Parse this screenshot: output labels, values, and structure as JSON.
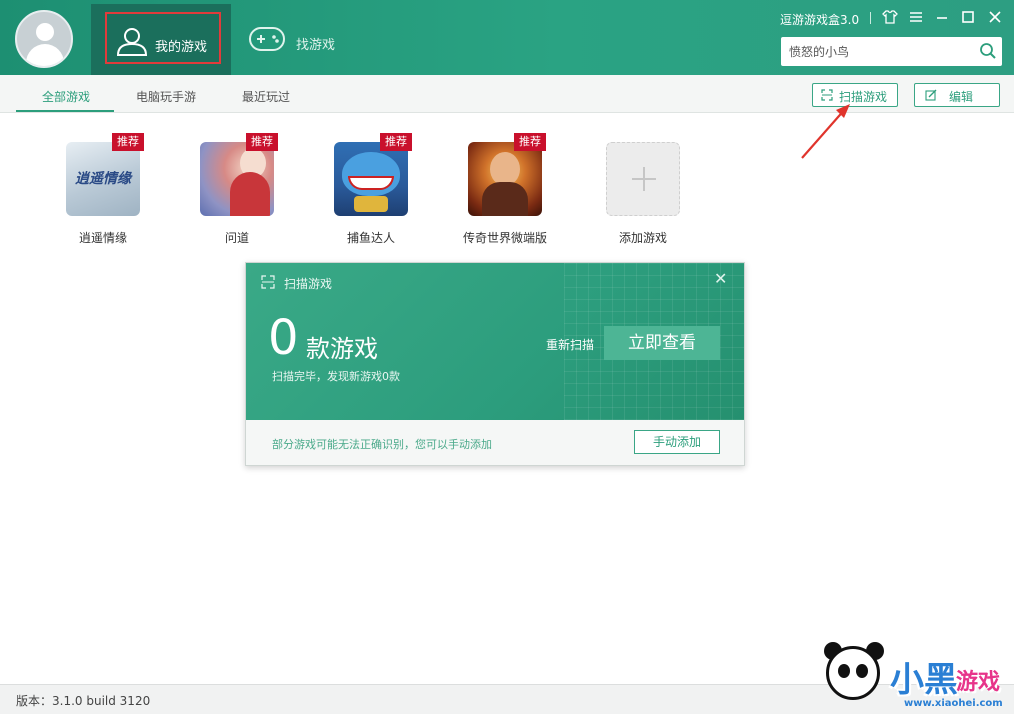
{
  "window": {
    "app_title": "逗游游戏盒3.0"
  },
  "nav": {
    "my_games": "我的游戏",
    "find_games": "找游戏"
  },
  "search": {
    "value": "愤怒的小鸟"
  },
  "tabs": [
    {
      "label": "全部游戏",
      "active": true
    },
    {
      "label": "电脑玩手游",
      "active": false
    },
    {
      "label": "最近玩过",
      "active": false
    }
  ],
  "toolbar": {
    "scan_label": "扫描游戏",
    "edit_label": "编辑"
  },
  "games": [
    {
      "name": "逍遥情缘",
      "badge": "推荐",
      "logo_text": "逍遥情缘"
    },
    {
      "name": "问道",
      "badge": "推荐"
    },
    {
      "name": "捕鱼达人",
      "badge": "推荐"
    },
    {
      "name": "传奇世界微端版",
      "badge": "推荐"
    },
    {
      "name": "添加游戏"
    }
  ],
  "scan_dialog": {
    "title": "扫描游戏",
    "count": "0",
    "count_unit": "款游戏",
    "subtitle": "扫描完毕，发现新游戏0款",
    "rescan_label": "重新扫描",
    "view_label": "立即查看",
    "note": "部分游戏可能无法正确识别，您可以手动添加",
    "manual_add_label": "手动添加"
  },
  "footer": {
    "version": "版本：3.1.0 build 3120"
  },
  "watermark": {
    "text1": "小黑",
    "text2": "游戏",
    "url": "www.xiaohei.com"
  },
  "colors": {
    "brand_green": "#2aa383",
    "badge_red": "#c9102c",
    "highlight_red": "#e23b3b"
  }
}
